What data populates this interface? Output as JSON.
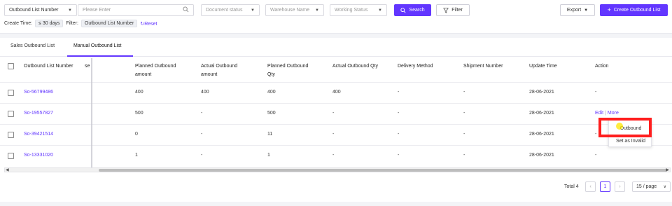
{
  "filters": {
    "search_field": "Outbound List Number",
    "search_placeholder": "Please Enter",
    "document_status": "Document status",
    "warehouse_name": "Warehouse Name",
    "working_status": "Working Status",
    "search_label": "Search",
    "filter_label": "Filter",
    "export_label": "Export",
    "create_label": "Create Outbound List"
  },
  "chips": {
    "create_time_label": "Create Time:",
    "create_time_value": "≤ 30 days",
    "filter_label": "Filter:",
    "filter_value": "Outbound List Number",
    "reset_label": "Reset"
  },
  "tabs": [
    {
      "label": "Sales Outbound List",
      "active": false
    },
    {
      "label": "Manual Outbound List",
      "active": true
    }
  ],
  "table": {
    "headers": {
      "number": "Outbound List Number",
      "partial": "se",
      "planned_amount_1": "Planned Outbound",
      "planned_amount_2": "amount",
      "actual_amount_1": "Actual Outbound",
      "actual_amount_2": "amount",
      "planned_qty_1": "Planned Outbound",
      "planned_qty_2": "Qty",
      "actual_qty": "Actual Outbound Qty",
      "delivery": "Delivery Method",
      "shipment": "Shipment Number",
      "update": "Update Time",
      "action": "Action"
    },
    "rows": [
      {
        "number": "So-56799486",
        "planned_amount": "400",
        "actual_amount": "400",
        "planned_qty": "400",
        "actual_qty": "400",
        "delivery": "-",
        "shipment": "-",
        "update": "28-06-2021",
        "action": "-"
      },
      {
        "number": "So-19557827",
        "planned_amount": "500",
        "actual_amount": "-",
        "planned_qty": "500",
        "actual_qty": "-",
        "delivery": "-",
        "shipment": "-",
        "update": "28-06-2021",
        "action_edit": "Edit",
        "action_sep": "|",
        "action_more": "More"
      },
      {
        "number": "So-39421514",
        "planned_amount": "0",
        "actual_amount": "-",
        "planned_qty": "11",
        "actual_qty": "-",
        "delivery": "-",
        "shipment": "-",
        "update": "28-06-2021",
        "action": "-"
      },
      {
        "number": "So-13331020",
        "planned_amount": "1",
        "actual_amount": "-",
        "planned_qty": "1",
        "actual_qty": "-",
        "delivery": "-",
        "shipment": "-",
        "update": "28-06-2021",
        "action": "-"
      }
    ]
  },
  "more_menu": {
    "outbound": "Outbound",
    "set_invalid": "Set as Invalid"
  },
  "pagination": {
    "total": "Total 4",
    "current_page": "1",
    "page_size": "15 / page"
  },
  "colors": {
    "accent": "#6236ff",
    "highlight": "#ff1e1e"
  }
}
